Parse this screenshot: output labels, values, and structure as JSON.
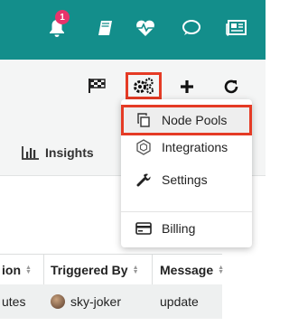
{
  "header": {
    "notification_count": "1",
    "icons": [
      "bell-icon",
      "book-icon",
      "heartbeat-icon",
      "chat-icon",
      "newspaper-icon"
    ]
  },
  "toolbar": {
    "icons": [
      "flag-icon",
      "gears-icon",
      "plus-icon",
      "refresh-icon"
    ],
    "insights_label": "Insights"
  },
  "dropdown": {
    "items": [
      {
        "label": "Node Pools",
        "icon": "copy-icon"
      },
      {
        "label": "Integrations",
        "icon": "hexagon-icon"
      },
      {
        "label": "Settings",
        "icon": "wrench-icon"
      },
      {
        "label": "Billing",
        "icon": "credit-card-icon"
      }
    ]
  },
  "table": {
    "columns": [
      "ion",
      "Triggered By",
      "Message"
    ],
    "rows": [
      {
        "duration": "utes",
        "triggered_by": "sky-joker",
        "message": "update"
      }
    ]
  },
  "colors": {
    "header_bg": "#138e8b",
    "highlight": "#e53b25",
    "badge": "#e8336b"
  }
}
